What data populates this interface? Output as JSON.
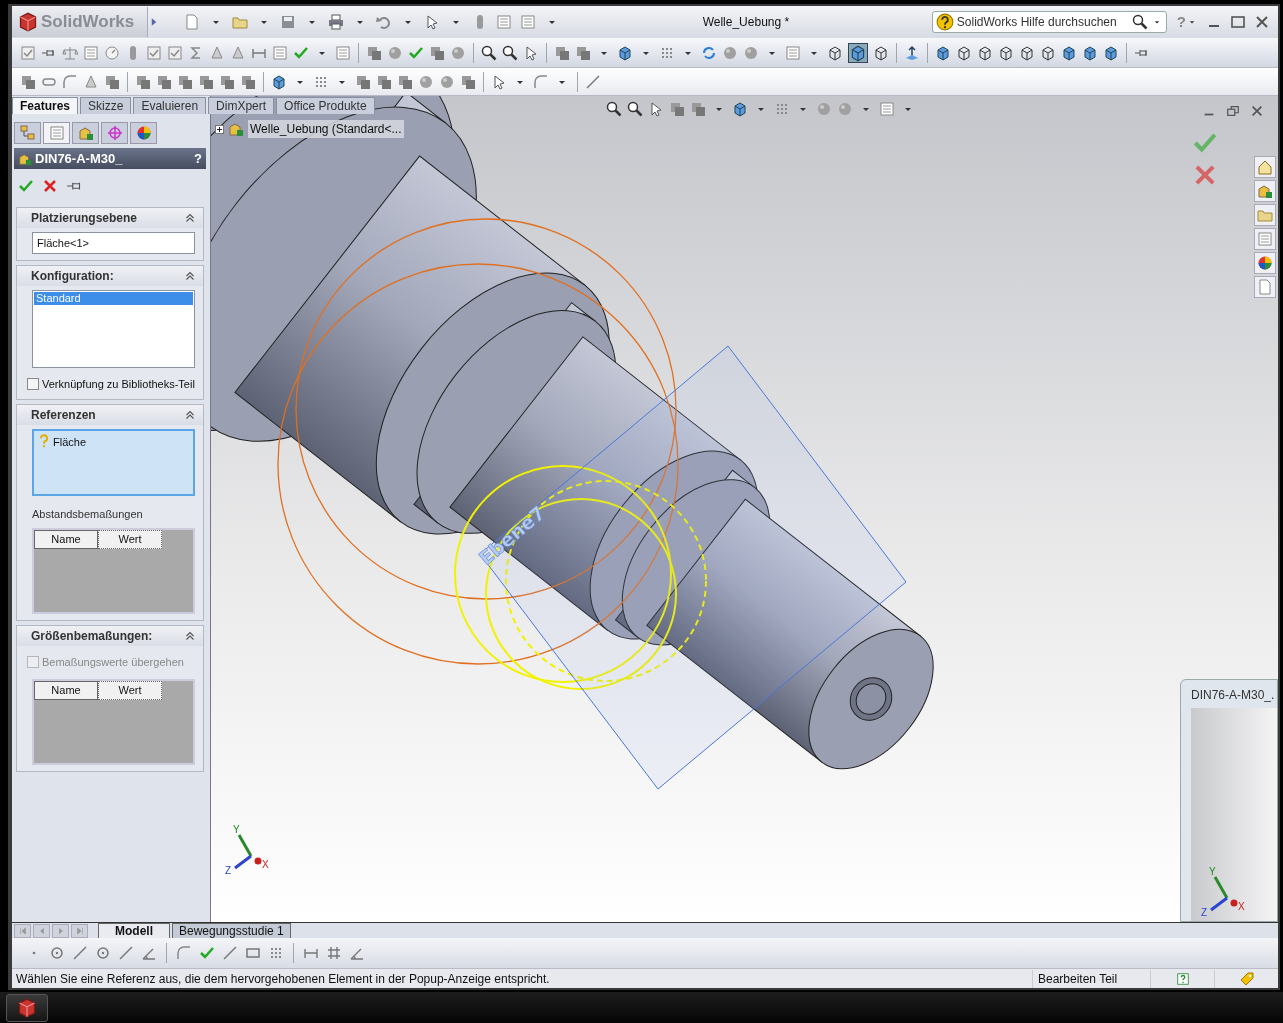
{
  "window": {
    "logo": "SolidWorks",
    "title": "Welle_Uebung *",
    "help": "?"
  },
  "search": {
    "placeholder": "SolidWorks Hilfe durchsuchen"
  },
  "command_tabs": [
    {
      "label": "Features",
      "selected": true
    },
    {
      "label": "Skizze",
      "selected": false
    },
    {
      "label": "Evaluieren",
      "selected": false
    },
    {
      "label": "DimXpert",
      "selected": false
    },
    {
      "label": "Office Produkte",
      "selected": false
    }
  ],
  "panel_tabs": [
    {
      "selected": false
    },
    {
      "selected": true
    },
    {
      "selected": false
    },
    {
      "selected": false
    },
    {
      "selected": false
    }
  ],
  "property_manager": {
    "title": "DIN76-A-M30_",
    "help": "?",
    "groups": [
      {
        "kind": "field",
        "title": "Platzierungsebene",
        "value": "Fläche<1>"
      },
      {
        "kind": "list",
        "title": "Konfiguration:",
        "items": [
          {
            "label": "Standard",
            "selected": true
          }
        ],
        "checkbox": {
          "label": "Verknüpfung zu Bibliotheks-Teil",
          "checked": false,
          "disabled": false
        }
      },
      {
        "kind": "references",
        "title": "Referenzen",
        "items": [
          "Fläche"
        ],
        "sublabel": "Abstandsbemaßungen",
        "columns": [
          "Name",
          "Wert"
        ]
      },
      {
        "kind": "table",
        "title": "Größenbemaßungen:",
        "checkbox": {
          "label": "Bemaßungswerte übergehen",
          "checked": false,
          "disabled": true
        },
        "columns": [
          "Name",
          "Wert"
        ]
      }
    ]
  },
  "feature_tree": {
    "label": "Welle_Uebung (Standard<...",
    "expanded": false
  },
  "viewport": {
    "plane_label": "Ebene7",
    "triad": {
      "x": "X",
      "y": "Y",
      "z": "Z"
    }
  },
  "preview_window": {
    "title": "DIN76-A-M30_.",
    "triad": {
      "x": "X",
      "y": "Y",
      "z": "Z"
    }
  },
  "bottom_tabs": [
    {
      "label": "Modell",
      "selected": true
    },
    {
      "label": "Bewegungsstudie 1",
      "selected": false
    }
  ],
  "status_bar": {
    "message": "Wählen Sie eine Referenz aus, die dem hervorgehobenen Element in der Popup-Anzeige entspricht.",
    "mode": "Bearbeiten Teil"
  }
}
